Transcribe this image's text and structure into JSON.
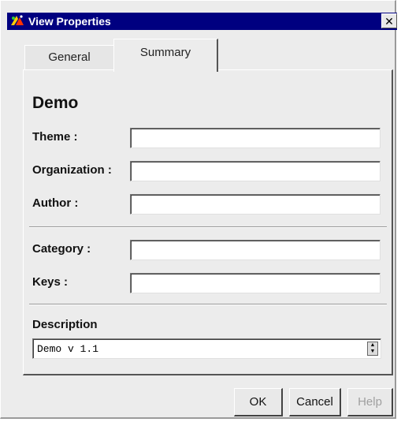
{
  "window": {
    "title": "View Properties",
    "close_glyph": "✕"
  },
  "tabs": [
    {
      "label": "General",
      "selected": false
    },
    {
      "label": "Summary",
      "selected": true
    }
  ],
  "summary": {
    "view_name": "Demo",
    "fields": {
      "theme": {
        "label": "Theme :",
        "value": ""
      },
      "organization": {
        "label": "Organization :",
        "value": ""
      },
      "author": {
        "label": "Author :",
        "value": ""
      },
      "category": {
        "label": "Category :",
        "value": ""
      },
      "keys": {
        "label": "Keys :",
        "value": ""
      }
    },
    "description": {
      "label": "Description",
      "value": "Demo v 1.1"
    }
  },
  "buttons": {
    "ok": "OK",
    "cancel": "Cancel",
    "help": "Help"
  },
  "colors": {
    "titlebar": "#000080",
    "disabled_text": "#a0a0a0"
  },
  "icons": {
    "app": "app-icon",
    "close": "close-icon",
    "spinner": "spinner-icon"
  }
}
